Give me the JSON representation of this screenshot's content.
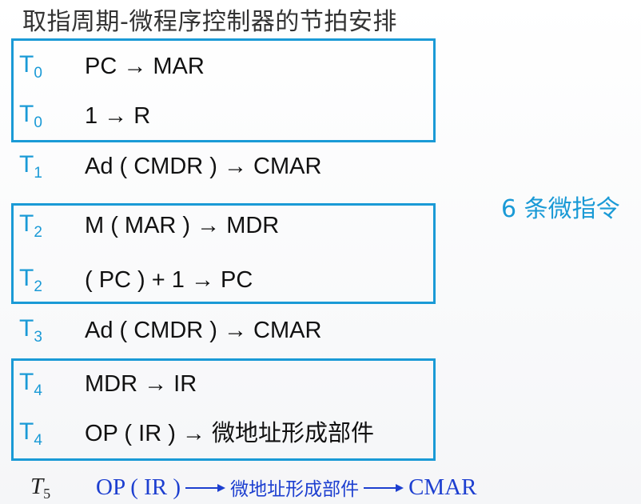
{
  "title": "取指周期-微程序控制器的节拍安排",
  "side_note": "6 条微指令",
  "rows": [
    {
      "t_main": "T",
      "t_sub": "0",
      "op": "PC → MAR"
    },
    {
      "t_main": "T",
      "t_sub": "0",
      "op": "1 → R"
    },
    {
      "t_main": "T",
      "t_sub": "1",
      "op": "Ad ( CMDR ) → CMAR"
    },
    {
      "t_main": "T",
      "t_sub": "2",
      "op": "M ( MAR ) → MDR"
    },
    {
      "t_main": "T",
      "t_sub": "2",
      "op": "( PC ) + 1 → PC"
    },
    {
      "t_main": "T",
      "t_sub": "3",
      "op": "Ad ( CMDR ) → CMAR"
    },
    {
      "t_main": "T",
      "t_sub": "4",
      "op": "MDR → IR"
    },
    {
      "t_main": "T",
      "t_sub": "4",
      "op": "OP ( IR ) → 微地址形成部件"
    }
  ],
  "last": {
    "t_main": "T",
    "t_sub": "5",
    "part1": "OP ( IR )",
    "part2": "微地址形成部件",
    "part3": "CMAR"
  },
  "colors": {
    "accent": "#1a9ad6",
    "last_row_text": "#1d3fd0"
  }
}
